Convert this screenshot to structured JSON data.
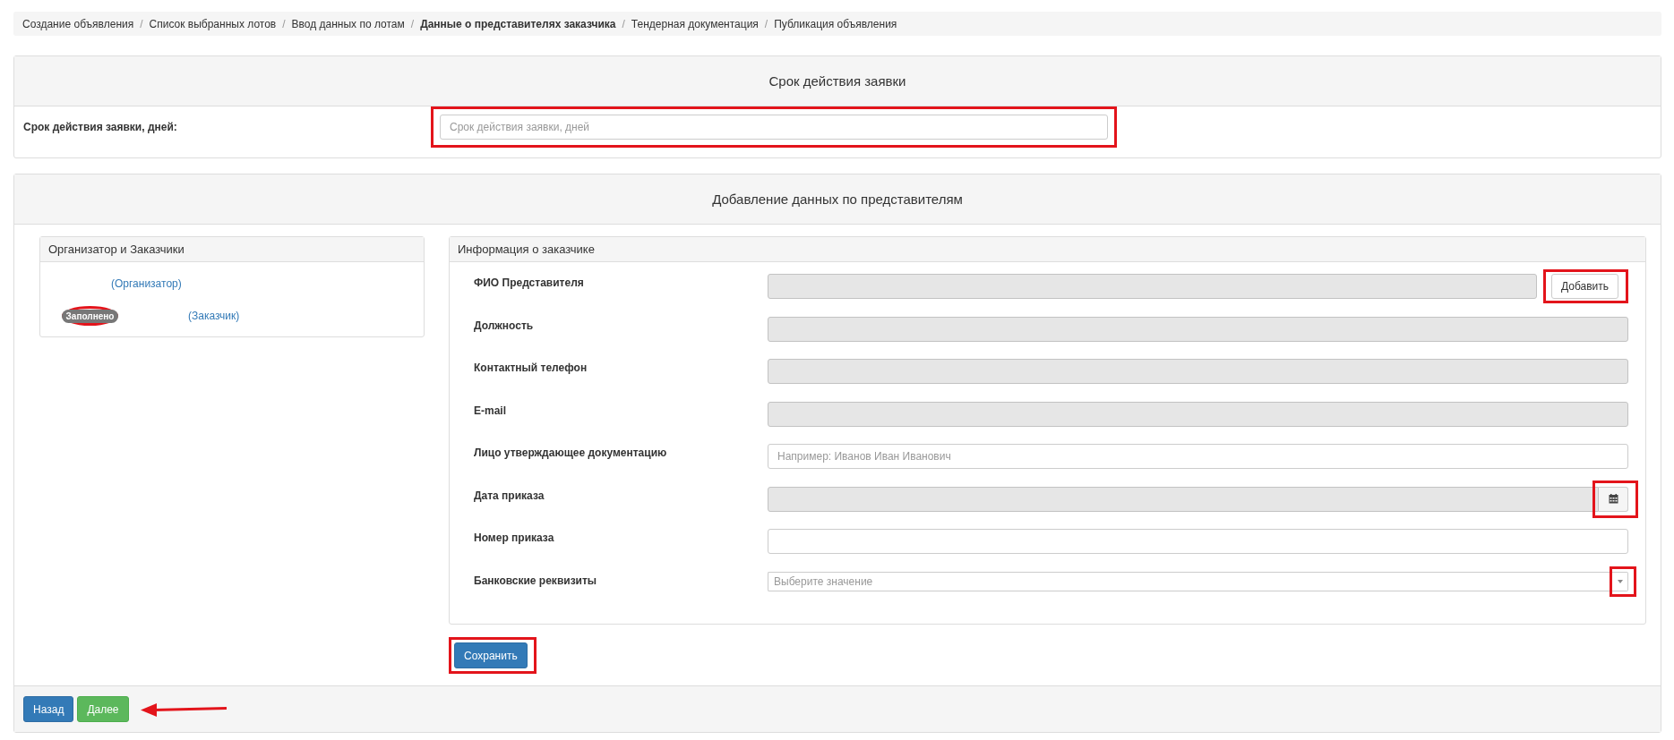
{
  "breadcrumb": [
    {
      "label": "Создание объявления",
      "current": false
    },
    {
      "separator_before": "/",
      "label": "Список выбранных лотов",
      "current": false
    },
    {
      "separator_before": "/",
      "label": "Ввод данных по лотам",
      "current": false
    },
    {
      "separator_before": "/",
      "label": "Данные о представителях заказчика",
      "current": true
    },
    {
      "separator_before": "/",
      "label": "Тендерная документация",
      "current": false
    },
    {
      "separator_before": "/",
      "label": "Публикация объявления",
      "current": false
    }
  ],
  "validity_panel": {
    "title": "Срок действия заявки",
    "label": "Срок действия заявки, дней:",
    "field": {
      "placeholder": "Срок действия заявки, дней",
      "highlighted": true
    }
  },
  "representatives_panel": {
    "title": "Добавление данных по представителям",
    "parties": {
      "title": "Организатор и Заказчики",
      "items": [
        {
          "role": "(Организатор)"
        },
        {
          "badge": "Заполнено",
          "badge_highlighted": true,
          "role": "(Заказчик)"
        }
      ]
    },
    "customer_info": {
      "title": "Информация о заказчике",
      "fields": [
        {
          "label": "ФИО Представителя",
          "kind": "text",
          "disabled": true,
          "button": {
            "label": "Добавить",
            "highlighted": true
          }
        },
        {
          "label": "Должность",
          "kind": "text",
          "disabled": true
        },
        {
          "label": "Контактный телефон",
          "kind": "text",
          "disabled": true
        },
        {
          "label": "E-mail",
          "kind": "text",
          "disabled": true
        },
        {
          "label": "Лицо утверждающее документацию",
          "kind": "text",
          "disabled": false,
          "placeholder": "Например: Иванов Иван Иванович"
        },
        {
          "label": "Дата приказа",
          "kind": "date",
          "disabled": true,
          "picker_highlighted": true
        },
        {
          "label": "Номер приказа",
          "kind": "text",
          "disabled": false
        },
        {
          "label": "Банковские реквизиты",
          "kind": "select",
          "placeholder": "Выберите значение",
          "toggle_highlighted": true
        }
      ]
    },
    "save_button": {
      "label": "Сохранить",
      "highlighted": true
    },
    "footer": {
      "buttons": [
        {
          "label": "Назад",
          "kind": "primary"
        },
        {
          "label": "Далее",
          "kind": "success"
        }
      ],
      "pointer_arrow": true
    }
  }
}
